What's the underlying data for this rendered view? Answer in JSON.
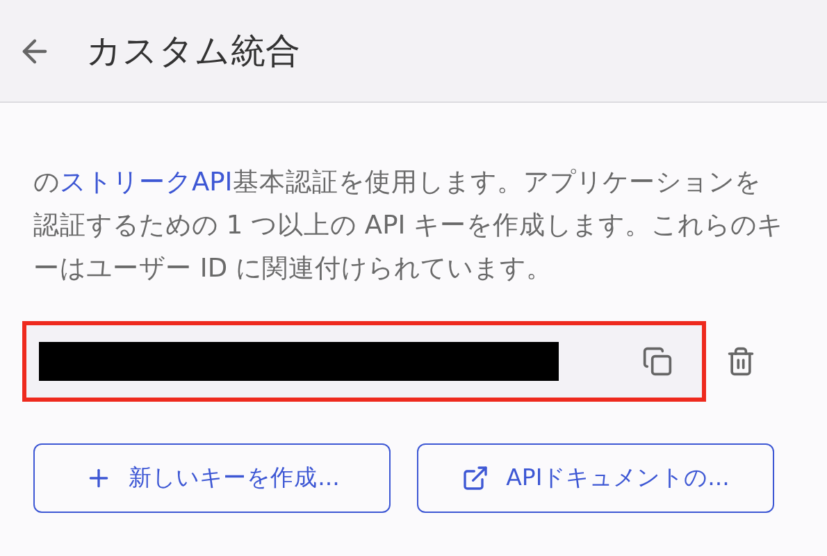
{
  "header": {
    "title": "カスタム統合"
  },
  "description": {
    "prefix": "の",
    "link": "ストリークAPI",
    "suffix": "基本認証を使用します。アプリケーションを認証するための 1 つ以上の API キーを作成します。これらのキーはユーザー ID に関連付けられています。"
  },
  "api_key": {
    "redacted": true,
    "highlighted": true
  },
  "buttons": [
    {
      "kind": "create",
      "label": "新しいキーを作成..."
    },
    {
      "kind": "docs",
      "label": "APIドキュメントの..."
    }
  ]
}
